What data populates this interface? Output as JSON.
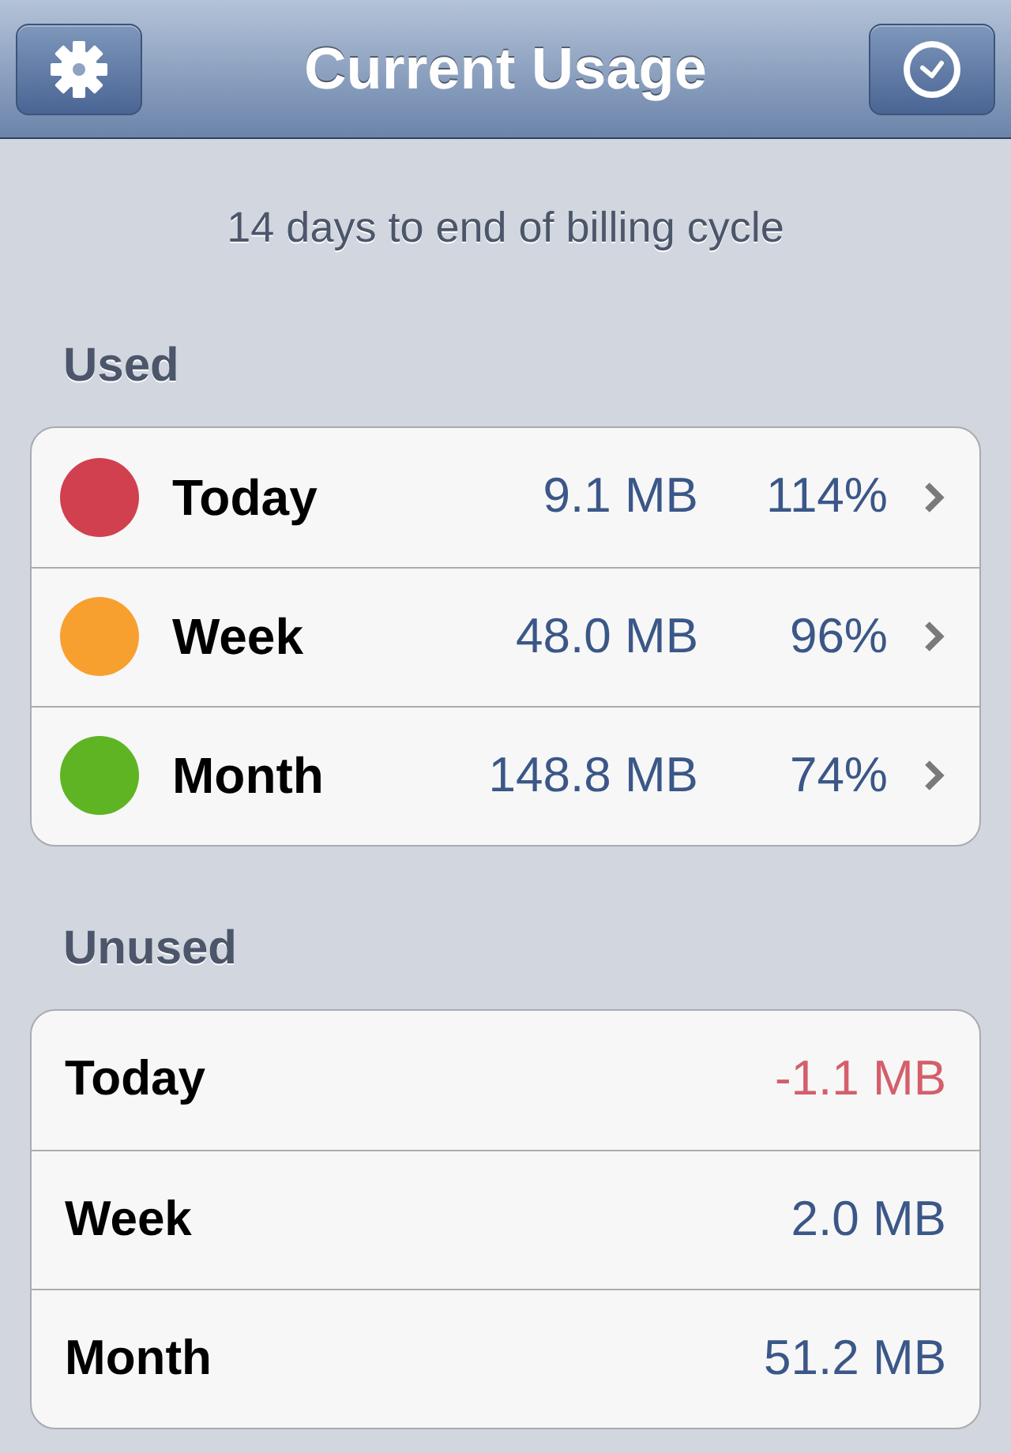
{
  "nav_bar": {
    "title": "Current Usage"
  },
  "subtitle": "14 days to end of billing cycle",
  "used": {
    "heading": "Used",
    "rows": [
      {
        "label": "Today",
        "amount": "9.1 MB",
        "percent": "114%",
        "color": "#d0404f"
      },
      {
        "label": "Week",
        "amount": "48.0 MB",
        "percent": "96%",
        "color": "#f7a030"
      },
      {
        "label": "Month",
        "amount": "148.8 MB",
        "percent": "74%",
        "color": "#5fb424"
      }
    ]
  },
  "unused": {
    "heading": "Unused",
    "rows": [
      {
        "label": "Today",
        "amount": "-1.1 MB",
        "negative": true
      },
      {
        "label": "Week",
        "amount": "2.0 MB",
        "negative": false
      },
      {
        "label": "Month",
        "amount": "51.2 MB",
        "negative": false
      }
    ]
  }
}
